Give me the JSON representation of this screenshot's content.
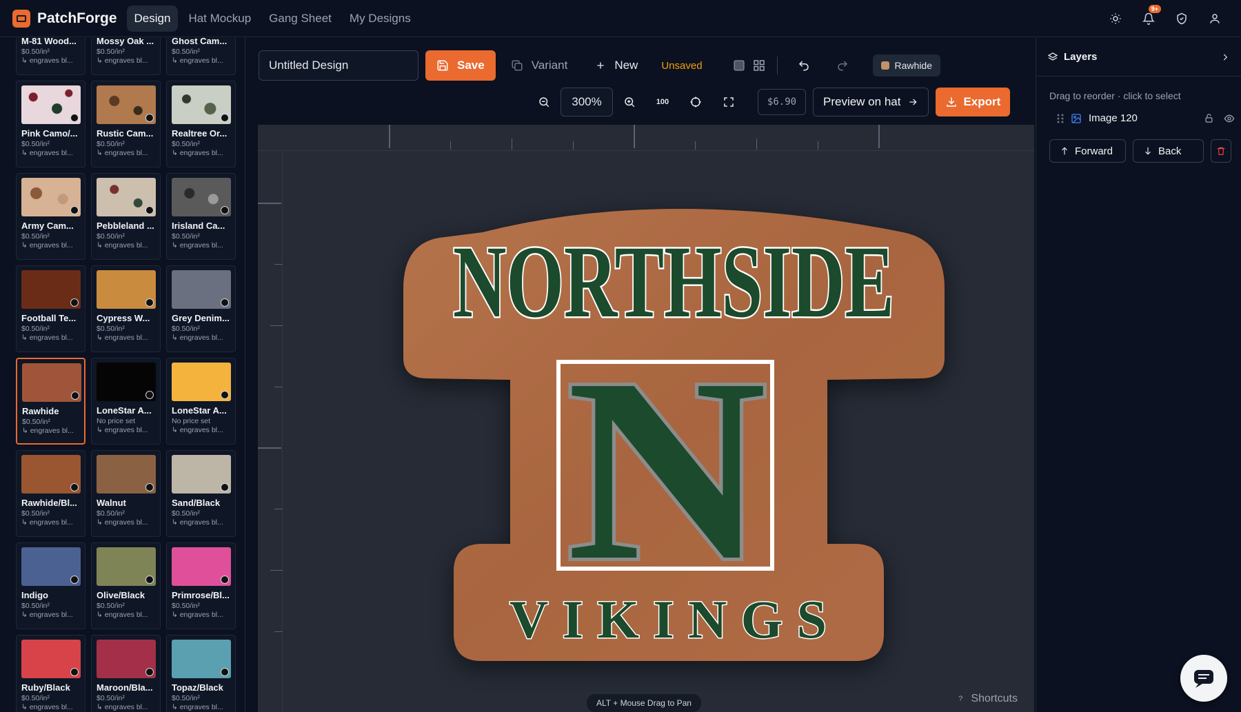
{
  "app": {
    "name": "PatchForge"
  },
  "nav": [
    {
      "label": "Design",
      "active": true
    },
    {
      "label": "Hat Mockup",
      "active": false
    },
    {
      "label": "Gang Sheet",
      "active": false
    },
    {
      "label": "My Designs",
      "active": false
    }
  ],
  "topbar": {
    "notification_badge": "9+"
  },
  "materials": [
    {
      "name": "M-81 Wood...",
      "price": "$0.50/in²",
      "engraves": "↳ engraves bl...",
      "swatch": "#4b4b3a"
    },
    {
      "name": "Mossy Oak ...",
      "price": "$0.50/in²",
      "engraves": "↳ engraves bl...",
      "swatch": "#5a4e3c"
    },
    {
      "name": "Ghost Cam...",
      "price": "$0.50/in²",
      "engraves": "↳ engraves bl...",
      "swatch": "#6b7280"
    },
    {
      "name": "Pink Camo/...",
      "price": "$0.50/in²",
      "engraves": "↳ engraves bl...",
      "swatch": "pink-camo"
    },
    {
      "name": "Rustic Cam...",
      "price": "$0.50/in²",
      "engraves": "↳ engraves bl...",
      "swatch": "rustic-camo"
    },
    {
      "name": "Realtree Or...",
      "price": "$0.50/in²",
      "engraves": "↳ engraves bl...",
      "swatch": "realtree"
    },
    {
      "name": "Army Cam...",
      "price": "$0.50/in²",
      "engraves": "↳ engraves bl...",
      "swatch": "army-camo"
    },
    {
      "name": "Pebbleland ...",
      "price": "$0.50/in²",
      "engraves": "↳ engraves bl...",
      "swatch": "pebbleland"
    },
    {
      "name": "Irisland Ca...",
      "price": "$0.50/in²",
      "engraves": "↳ engraves bl...",
      "swatch": "irisland"
    },
    {
      "name": "Football Te...",
      "price": "$0.50/in²",
      "engraves": "↳ engraves bl...",
      "swatch": "#6b2c17"
    },
    {
      "name": "Cypress W...",
      "price": "$0.50/in²",
      "engraves": "↳ engraves bl...",
      "swatch": "#c98b3e"
    },
    {
      "name": "Grey Denim...",
      "price": "$0.50/in²",
      "engraves": "↳ engraves bl...",
      "swatch": "#6b7080"
    },
    {
      "name": "Rawhide",
      "price": "$0.50/in²",
      "engraves": "↳ engraves bl...",
      "swatch": "#a0553a",
      "selected": true
    },
    {
      "name": "LoneStar A...",
      "price": "No price set",
      "engraves": "↳ engraves bl...",
      "swatch": "#050505"
    },
    {
      "name": "LoneStar A...",
      "price": "No price set",
      "engraves": "↳ engraves bl...",
      "swatch": "#f3b33d"
    },
    {
      "name": "Rawhide/Bl...",
      "price": "$0.50/in²",
      "engraves": "↳ engraves bl...",
      "swatch": "#9a5630"
    },
    {
      "name": "Walnut",
      "price": "$0.50/in²",
      "engraves": "↳ engraves bl...",
      "swatch": "#8a6243"
    },
    {
      "name": "Sand/Black",
      "price": "$0.50/in²",
      "engraves": "↳ engraves bl...",
      "swatch": "#bdb6a6"
    },
    {
      "name": "Indigo",
      "price": "$0.50/in²",
      "engraves": "↳ engraves bl...",
      "swatch": "#4a6191"
    },
    {
      "name": "Olive/Black",
      "price": "$0.50/in²",
      "engraves": "↳ engraves bl...",
      "swatch": "#7f8456"
    },
    {
      "name": "Primrose/Bl...",
      "price": "$0.50/in²",
      "engraves": "↳ engraves bl...",
      "swatch": "#e0509a"
    },
    {
      "name": "Ruby/Black",
      "price": "$0.50/in²",
      "engraves": "↳ engraves bl...",
      "swatch": "#d8434a"
    },
    {
      "name": "Maroon/Bla...",
      "price": "$0.50/in²",
      "engraves": "↳ engraves bl...",
      "swatch": "#a33048"
    },
    {
      "name": "Topaz/Black",
      "price": "$0.50/in²",
      "engraves": "↳ engraves bl...",
      "swatch": "#5aa0b0"
    }
  ],
  "toolbar": {
    "design_name": "Untitled Design",
    "save_label": "Save",
    "variant_label": "Variant",
    "new_label": "New",
    "status": "Unsaved",
    "material_chip": "Rawhide",
    "zoom": "300%",
    "zoom_100": "100",
    "price": "$6.90",
    "preview_label": "Preview on hat",
    "export_label": "Export"
  },
  "canvas": {
    "patch_top_text": "NORTHSIDE",
    "patch_letter": "N",
    "patch_bottom_text": "VIKINGS",
    "hint": "ALT + Mouse Drag to Pan",
    "shortcuts_label": "Shortcuts"
  },
  "layers": {
    "title": "Layers",
    "hint": "Drag to reorder · click to select",
    "items": [
      {
        "name": "Image 120"
      }
    ],
    "forward_label": "Forward",
    "back_label": "Back"
  },
  "colors": {
    "accent": "#ea6a2f",
    "patch_leather": "#b06a43",
    "patch_green": "#1c4a2c"
  }
}
